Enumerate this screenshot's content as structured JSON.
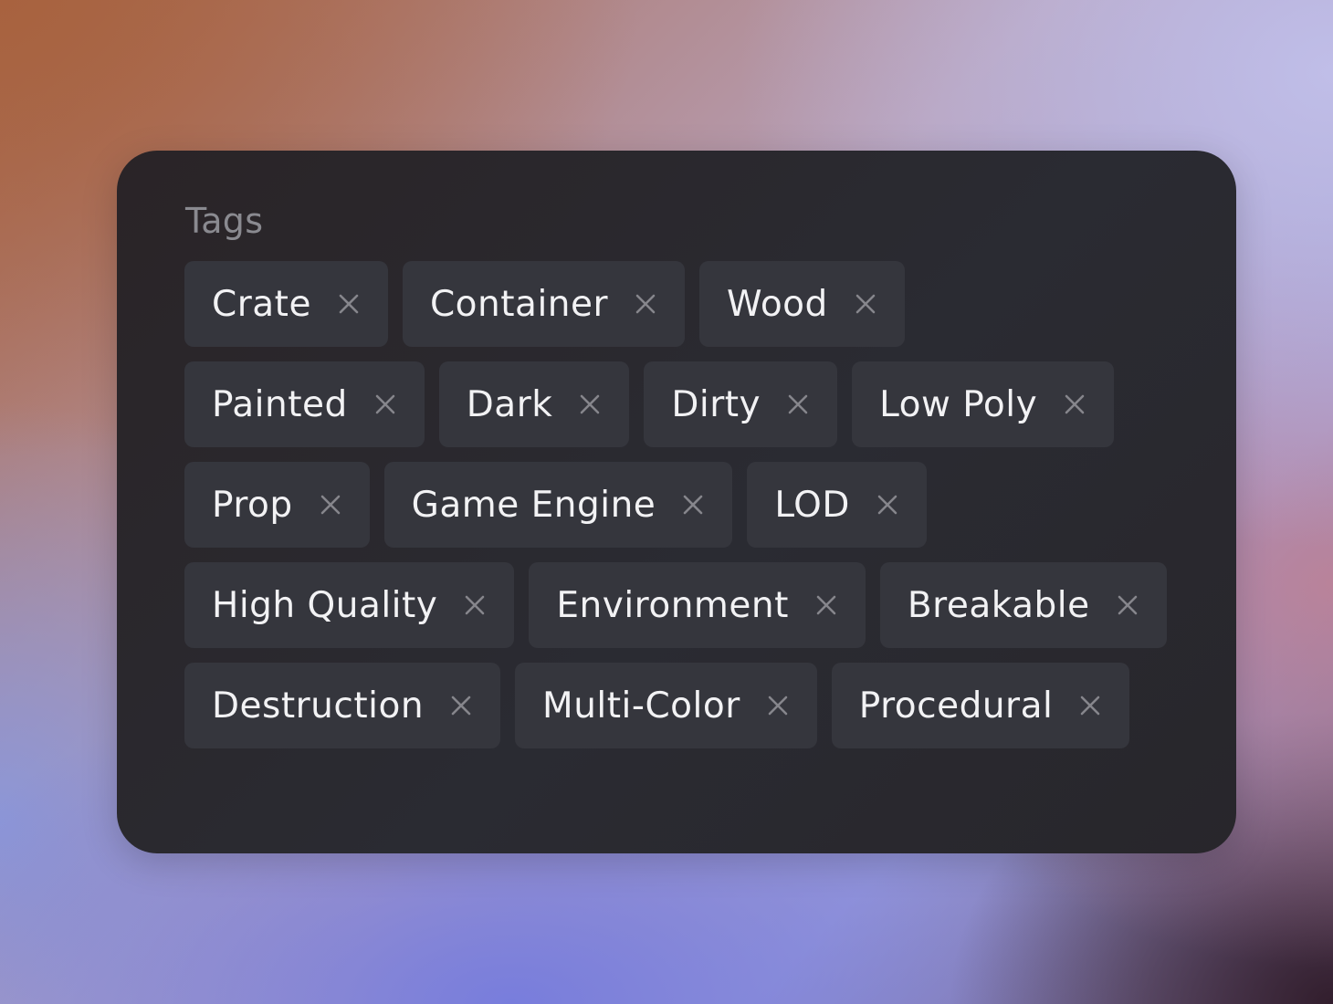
{
  "panel": {
    "title": "Tags",
    "remove_icon": "close-icon",
    "rows": [
      [
        "Crate",
        "Container",
        "Wood"
      ],
      [
        "Painted",
        "Dark",
        "Dirty",
        "Low Poly"
      ],
      [
        "Prop",
        "Game Engine",
        "LOD"
      ],
      [
        "High Quality",
        "Environment",
        "Breakable"
      ],
      [
        "Destruction",
        "Multi-Color",
        "Procedural"
      ]
    ]
  }
}
